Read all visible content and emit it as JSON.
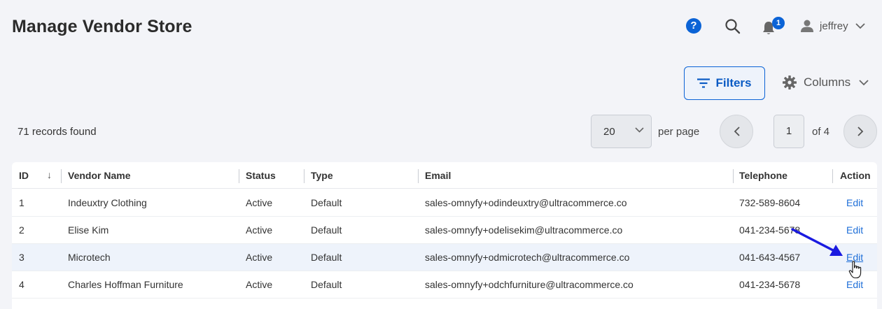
{
  "header": {
    "title": "Manage Vendor Store",
    "help_glyph": "?",
    "notifications_count": "1",
    "user_name": "jeffrey"
  },
  "toolbar": {
    "filters_label": "Filters",
    "columns_label": "Columns"
  },
  "summary": {
    "records_found": "71 records found"
  },
  "pagination": {
    "page_size": "20",
    "per_page_label": "per page",
    "current_page": "1",
    "of_pages": "of 4"
  },
  "table": {
    "columns": [
      "ID",
      "Vendor Name",
      "Status",
      "Type",
      "Email",
      "Telephone",
      "Action"
    ],
    "rows": [
      {
        "id": "1",
        "vendor_name": "Indeuxtry Clothing",
        "status": "Active",
        "type": "Default",
        "email": "sales-omnyfy+odindeuxtry@ultracommerce.co",
        "telephone": "732-589-8604",
        "action": "Edit"
      },
      {
        "id": "2",
        "vendor_name": "Elise Kim",
        "status": "Active",
        "type": "Default",
        "email": "sales-omnyfy+odelisekim@ultracommerce.co",
        "telephone": "041-234-5678",
        "action": "Edit"
      },
      {
        "id": "3",
        "vendor_name": "Microtech",
        "status": "Active",
        "type": "Default",
        "email": "sales-omnyfy+odmicrotech@ultracommerce.co",
        "telephone": "041-643-4567",
        "action": "Edit"
      },
      {
        "id": "4",
        "vendor_name": "Charles Hoffman Furniture",
        "status": "Active",
        "type": "Default",
        "email": "sales-omnyfy+odchfurniture@ultracommerce.co",
        "telephone": "041-234-5678",
        "action": "Edit"
      }
    ]
  },
  "colors": {
    "accent": "#0b63d6",
    "link": "#1f6fd8",
    "annotation_arrow": "#1a1ae0",
    "highlight_row": "#eef3fb"
  }
}
